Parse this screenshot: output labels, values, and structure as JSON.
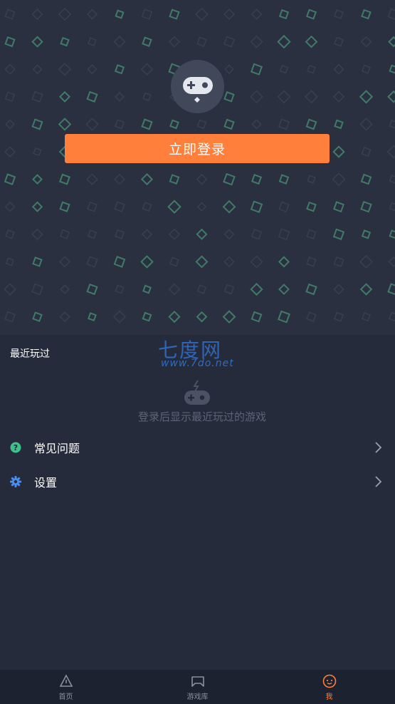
{
  "profile": {
    "login_button": "立即登录"
  },
  "recent": {
    "title": "最近玩过",
    "empty_text": "登录后显示最近玩过的游戏"
  },
  "watermark": {
    "main": "七度网",
    "sub": "www.7do.net"
  },
  "menu": {
    "items": [
      {
        "label": "常见问题",
        "icon": "question-icon"
      },
      {
        "label": "设置",
        "icon": "gear-icon"
      }
    ]
  },
  "tabbar": {
    "tabs": [
      {
        "label": "首页",
        "icon": "triangle-icon",
        "active": false
      },
      {
        "label": "游戏库",
        "icon": "library-icon",
        "active": false
      },
      {
        "label": "我",
        "icon": "smiley-icon",
        "active": true
      }
    ]
  },
  "colors": {
    "accent": "#ff7f3b",
    "background": "#252b3a",
    "hero_background": "#2a303f"
  }
}
